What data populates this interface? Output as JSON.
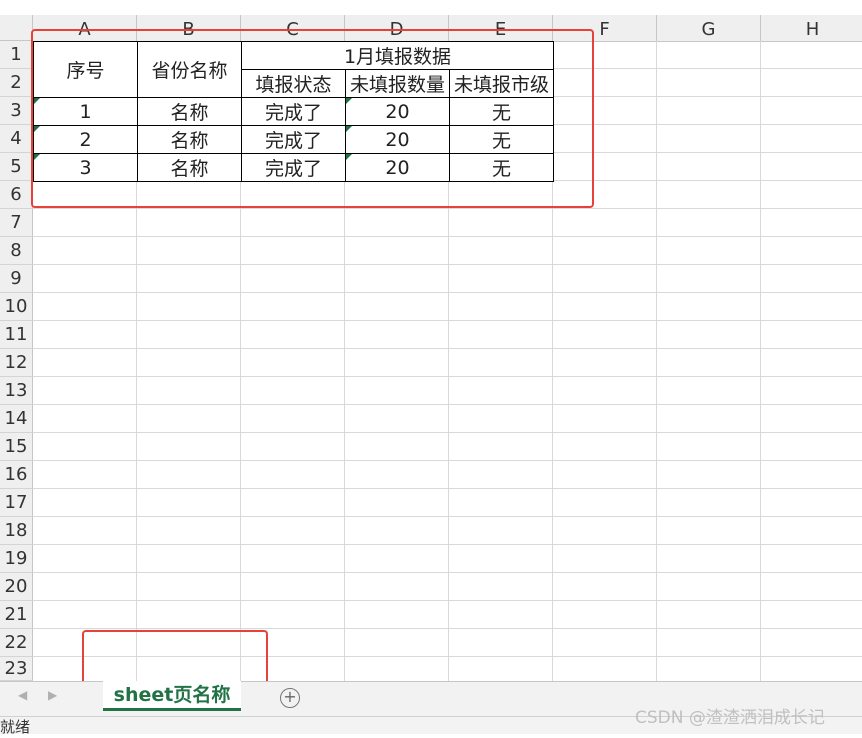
{
  "columns": [
    "A",
    "B",
    "C",
    "D",
    "E",
    "F",
    "G",
    "H"
  ],
  "rows": [
    "1",
    "2",
    "3",
    "4",
    "5",
    "6",
    "7",
    "8",
    "9",
    "10",
    "11",
    "12",
    "13",
    "14",
    "15",
    "16",
    "17",
    "18",
    "19",
    "20",
    "21",
    "22",
    "23"
  ],
  "header": {
    "seq": "序号",
    "province": "省份名称",
    "group_title": "1月填报数据",
    "status": "填报状态",
    "unfilled_count": "未填报数量",
    "unfilled_city": "未填报市级"
  },
  "data_rows": [
    {
      "seq": "1",
      "name": "名称",
      "status": "完成了",
      "count": "20",
      "city": "无"
    },
    {
      "seq": "2",
      "name": "名称",
      "status": "完成了",
      "count": "20",
      "city": "无"
    },
    {
      "seq": "3",
      "name": "名称",
      "status": "完成了",
      "count": "20",
      "city": "无"
    }
  ],
  "sheet_tab": "sheet页名称",
  "add_sheet_icon": "plus-circle-icon",
  "status_bar": "就绪",
  "watermark": "CSDN @渣渣洒泪成长记",
  "colors": {
    "accent": "#217346",
    "annotation": "#e8413a"
  }
}
